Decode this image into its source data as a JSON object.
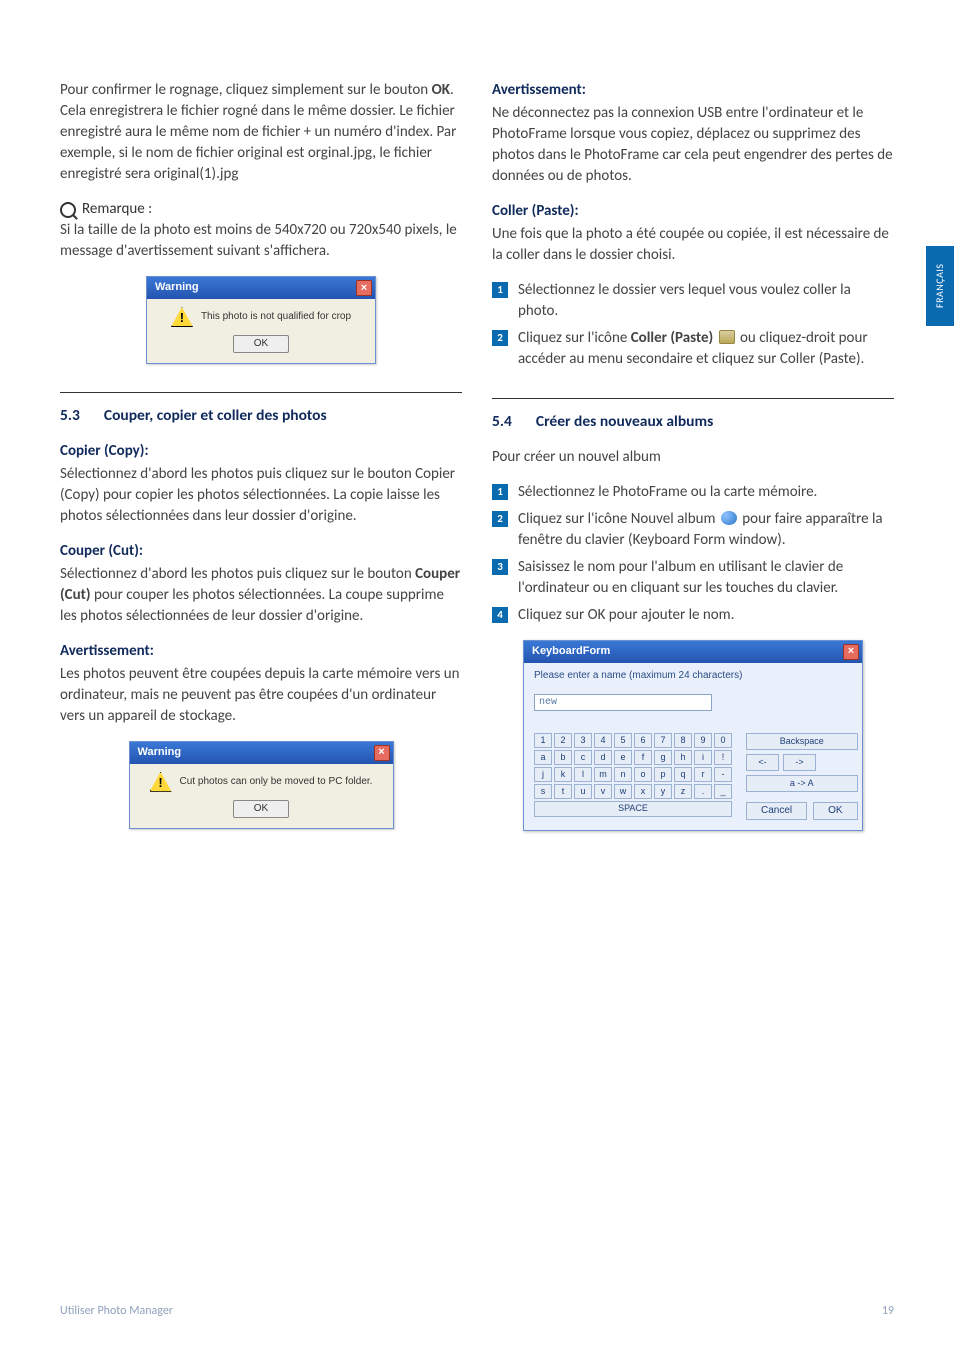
{
  "side_tab": "FRANÇAIS",
  "left": {
    "intro_before_bold": "Pour confirmer le rognage, cliquez simplement sur le bouton ",
    "intro_bold": "OK",
    "intro_after_bold": ". Cela enregistrera le fichier rogné dans le même dossier. Le fichier enregistré aura le même nom de fichier + un numéro d'index. Par exemple, si le nom de fichier original est orginal.jpg, le fichier enregistré sera original(1).jpg",
    "note_label": "Remarque :",
    "note_text": "Si la taille de la photo est moins de 540x720 ou 720x540 pixels, le message d'avertissement suivant s'affichera.",
    "dialog1": {
      "title": "Warning",
      "msg": "This photo is not qualified for crop",
      "ok": "OK"
    },
    "sec53_num": "5.3",
    "sec53_title": "Couper, copier et coller des photos",
    "copy_head": "Copier (Copy)",
    "copy_text": "Sélectionnez d'abord les photos puis cliquez sur le bouton Copier (Copy) pour copier les photos sélectionnées. La copie laisse les photos sélectionnées dans leur dossier d'origine.",
    "cut_head": "Couper (Cut)",
    "cut_before_bold": "Sélectionnez d'abord les photos puis cliquez sur le bouton ",
    "cut_bold": "Couper (Cut)",
    "cut_after_bold": " pour couper les photos sélectionnées. La coupe supprime les photos sélectionnées de leur dossier d'origine.",
    "avert_head": "Avertissement",
    "avert_text": "Les photos peuvent être coupées depuis la carte mémoire vers un ordinateur, mais ne peuvent pas être coupées d'un ordinateur vers un appareil de stockage.",
    "dialog2": {
      "title": "Warning",
      "msg": "Cut photos can only be moved to PC folder.",
      "ok": "OK"
    }
  },
  "right": {
    "avert_head": "Avertissement:",
    "avert_text": "Ne déconnectez pas la connexion USB entre l'ordinateur et le PhotoFrame lorsque vous copiez, déplacez ou supprimez des photos dans le PhotoFrame car cela peut engendrer des pertes de données ou de photos.",
    "paste_head": "Coller (Paste):",
    "paste_text": "Une fois que la photo a été coupée ou copiée, il est nécessaire de la coller dans le dossier choisi.",
    "paste_steps": {
      "1": "Sélectionnez le dossier vers lequel vous voulez coller la photo.",
      "2_before_bold": "Cliquez sur l'icône ",
      "2_bold": "Coller (Paste)",
      "2_after_icon": " ou cliquez-droit pour accéder au menu secondaire et cliquez sur Coller (Paste)."
    },
    "sec54_num": "5.4",
    "sec54_title": "Créer des nouveaux albums",
    "sec54_intro": "Pour créer un nouvel album",
    "album_steps": {
      "1": " Sélectionnez le PhotoFrame ou la carte mémoire.",
      "2_before": "Cliquez sur l'icône Nouvel album ",
      "2_after": " pour faire apparaître la fenêtre du clavier (Keyboard Form window).",
      "3": "Saisissez le nom pour l'album en utilisant le clavier de l'ordinateur ou en cliquant sur les touches du clavier.",
      "4": "Cliquez sur OK pour ajouter le nom."
    },
    "kb": {
      "title": "KeyboardForm",
      "prompt": "Please enter a name (maximum 24 characters)",
      "value": "new",
      "row1": [
        "1",
        "2",
        "3",
        "4",
        "5",
        "6",
        "7",
        "8",
        "9",
        "0"
      ],
      "row2": [
        "a",
        "b",
        "c",
        "d",
        "e",
        "f",
        "g",
        "h",
        "i",
        "!"
      ],
      "row3": [
        "j",
        "k",
        "l",
        "m",
        "n",
        "o",
        "p",
        "q",
        "r",
        "-"
      ],
      "row4": [
        "s",
        "t",
        "u",
        "v",
        "w",
        "x",
        "y",
        "z",
        ".",
        "_"
      ],
      "space": "SPACE",
      "backspace": "Backspace",
      "left": "<-",
      "right_arrow": "->",
      "shift": "a -> A",
      "cancel": "Cancel",
      "ok": "OK"
    }
  },
  "footer": {
    "left": "Utiliser Photo Manager",
    "right": "19"
  }
}
